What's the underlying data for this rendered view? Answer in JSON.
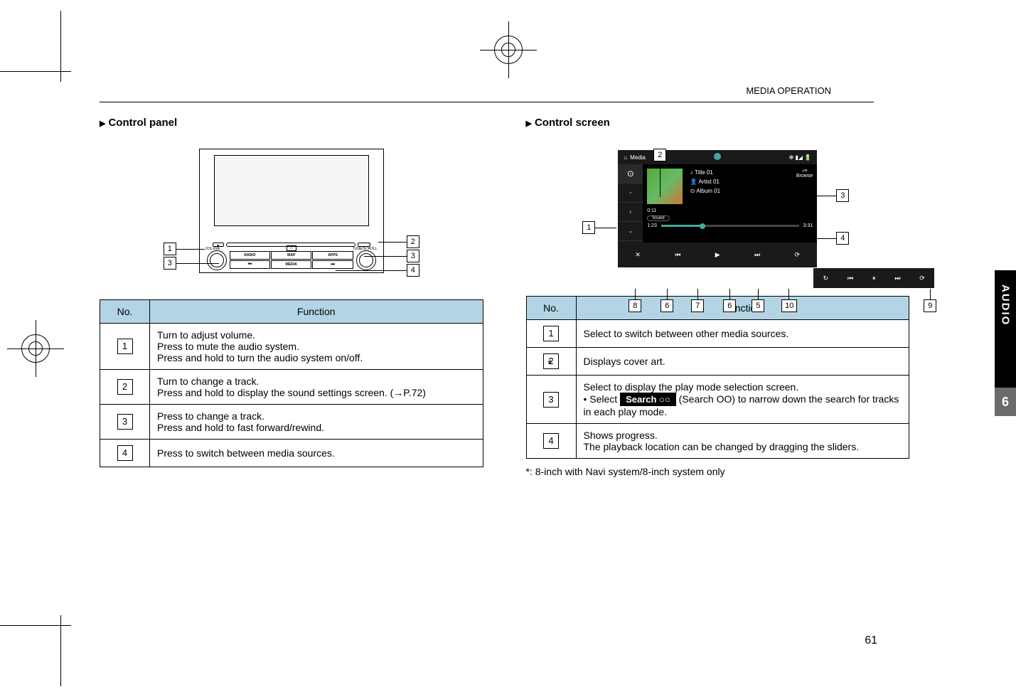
{
  "header": {
    "section_label": "MEDIA OPERATION"
  },
  "left_column": {
    "heading": "Control panel",
    "panel_labels": {
      "volume": "VOLUME",
      "radio": "RADIO",
      "map": "MAP",
      "apps": "APPS",
      "media": "MEDIA",
      "tune_scroll": "TUNE/SCROLL"
    },
    "callouts": [
      "1",
      "2",
      "3",
      "4"
    ],
    "table": {
      "headers": {
        "no": "No.",
        "function": "Function"
      },
      "rows": [
        {
          "no": "1",
          "desc": "Turn to adjust volume.\nPress to mute the audio system.\nPress and hold to turn the audio system on/off."
        },
        {
          "no": "2",
          "desc": "Turn to change a track.\nPress and hold to display the sound settings screen. (→P.72)"
        },
        {
          "no": "3",
          "desc": "Press to change a track.\nPress and hold to fast forward/rewind."
        },
        {
          "no": "4",
          "desc": "Press to switch between media sources."
        }
      ]
    }
  },
  "right_column": {
    "heading": "Control screen",
    "screen": {
      "media_label": "Media",
      "title": "Title 01",
      "artist": "Artist 01",
      "album": "Album 01",
      "browse": "Browse",
      "time_left": "0:11",
      "time_current": "1:23",
      "time_total": "3:31",
      "sound": "Sound",
      "shuffle": "Shuffle",
      "repeat": "Repeat",
      "sidebar_items": [
        "Audio CD",
        "iPod",
        "Aux"
      ]
    },
    "callouts": [
      "1",
      "2",
      "3",
      "4",
      "5",
      "6",
      "7",
      "8",
      "9",
      "10"
    ],
    "table": {
      "headers": {
        "no": "No.",
        "function": "Function"
      },
      "rows": [
        {
          "no": "1",
          "star": false,
          "desc": "Select to switch between other media sources."
        },
        {
          "no": "2",
          "star": true,
          "desc": "Displays cover art."
        },
        {
          "no": "3",
          "star": false,
          "desc_pre": "Select to display the play mode selection screen.",
          "desc_bullet": "• Select ",
          "search_label": "Search ○○",
          "desc_after": " (Search OO) to narrow down the search for tracks in each play mode."
        },
        {
          "no": "4",
          "star": false,
          "desc": "Shows progress.\nThe playback location can be changed by dragging the sliders."
        }
      ]
    },
    "footnote": "*: 8-inch with Navi system/8-inch system only"
  },
  "side": {
    "tab_label": "AUDIO",
    "chapter": "6"
  },
  "page_number": "61"
}
